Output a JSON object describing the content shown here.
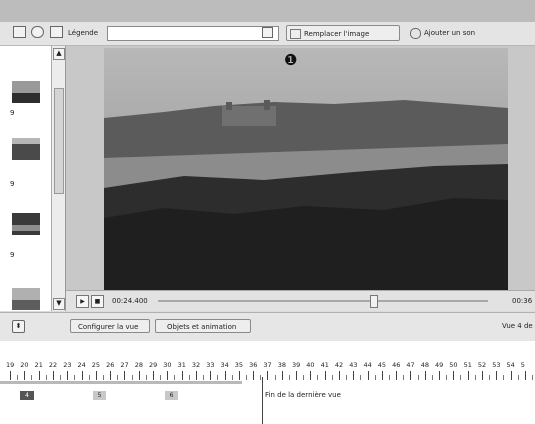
{
  "toolbar": {
    "caption_label": "Légende",
    "caption_value": "",
    "replace_image_label": "Remplacer l'image",
    "add_sound_label": "Ajouter un son"
  },
  "callout": {
    "number": "❶"
  },
  "player": {
    "time_current": "00:24.400",
    "time_total": "00:36",
    "progress": 0.65
  },
  "view_row": {
    "configure_label": "Configurer la vue",
    "objects_label": "Objets et animation",
    "view_status": "Vue 4 de"
  },
  "left_pane": {
    "thumb_numbers": [
      "9",
      "9",
      "9"
    ]
  },
  "timeline": {
    "ticks": [
      "19",
      "20",
      "21",
      "22",
      "23",
      "24",
      "25",
      "26",
      "27",
      "28",
      "29",
      "30",
      "31",
      "32",
      "33",
      "34",
      "35",
      "36",
      "37",
      "38",
      "39",
      "40",
      "41",
      "42",
      "43",
      "44",
      "45",
      "46",
      "47",
      "48",
      "49",
      "50",
      "51",
      "52",
      "53",
      "54",
      "5"
    ],
    "clips": [
      "4",
      "5",
      "6"
    ],
    "end_label": "Fin de la dernière vue"
  },
  "colors": {
    "toolbar_bg": "#e4e4e4",
    "stage_bg": "#c8c8c8",
    "timeline_bg": "#ffffff"
  }
}
